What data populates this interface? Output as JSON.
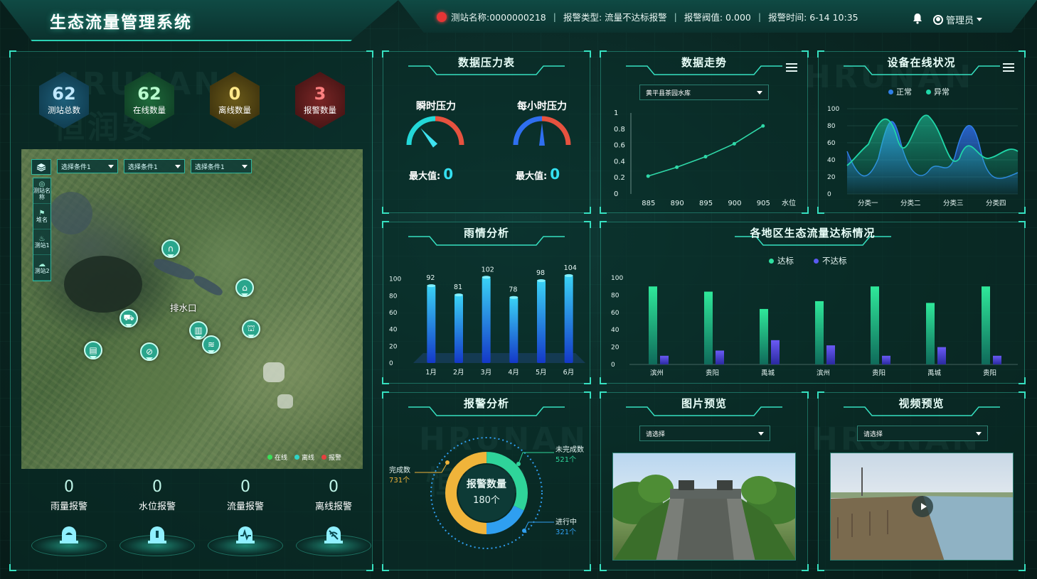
{
  "header": {
    "title": "生态流量管理系统",
    "alarm": {
      "station": "测站名称:0000000218",
      "type": "报警类型:  流量不达标报警",
      "threshold": "报警阀值:  0.000",
      "time": "报警时间:  6-14 10:35"
    },
    "user": "管理员"
  },
  "summary": [
    {
      "value": "62",
      "label": "测站总数",
      "color": "#4fb6e8"
    },
    {
      "value": "62",
      "label": "在线数量",
      "color": "#3de07a"
    },
    {
      "value": "0",
      "label": "离线数量",
      "color": "#e8c238"
    },
    {
      "value": "3",
      "label": "报警数量",
      "color": "#e84848"
    }
  ],
  "map": {
    "selects": [
      "选择条件1",
      "选择条件1",
      "选择条件1"
    ],
    "side_items": [
      "测站名称",
      "堆名",
      "测站1",
      "测站2"
    ],
    "label": "排水口",
    "legend": [
      "在线",
      "离线",
      "报警"
    ]
  },
  "alarms": [
    {
      "value": "0",
      "label": "雨量报警"
    },
    {
      "value": "0",
      "label": "水位报警"
    },
    {
      "value": "0",
      "label": "流量报警"
    },
    {
      "value": "0",
      "label": "离线报警"
    }
  ],
  "pressure": {
    "title": "数据压力表",
    "instant": {
      "label": "瞬时压力",
      "max_label": "最大值:",
      "max": "0"
    },
    "hourly": {
      "label": "每小时压力",
      "max_label": "最大值:",
      "max": "0"
    }
  },
  "trend": {
    "title": "数据走势",
    "select": "黄平县茶园水库",
    "chart_data": {
      "type": "line",
      "x": [
        885,
        890,
        895,
        900,
        905
      ],
      "y": [
        0.22,
        0.33,
        0.46,
        0.62,
        0.84
      ],
      "xlabel": "水位",
      "yticks": [
        "0",
        "0.2",
        "0.4",
        "0.6",
        "0.8",
        "1"
      ],
      "xticks": [
        "885",
        "890",
        "895",
        "900",
        "905"
      ]
    }
  },
  "online": {
    "title": "设备在线状况",
    "legend": [
      {
        "name": "正常",
        "color": "#2f7fe8"
      },
      {
        "name": "异常",
        "color": "#20d6a8"
      }
    ],
    "chart_data": {
      "type": "area",
      "categories": [
        "分类一",
        "分类二",
        "分类三",
        "分类四"
      ],
      "yticks": [
        "0",
        "20",
        "40",
        "60",
        "80",
        "100"
      ]
    }
  },
  "rain": {
    "title": "雨情分析",
    "chart_data": {
      "type": "bar",
      "categories": [
        "1月",
        "2月",
        "3月",
        "4月",
        "5月",
        "6月"
      ],
      "values": [
        92,
        81,
        102,
        78,
        98,
        104
      ],
      "yticks": [
        "0",
        "20",
        "40",
        "60",
        "80",
        "100"
      ]
    }
  },
  "region": {
    "title": "各地区生态流量达标情况",
    "chart_data": {
      "type": "bar",
      "categories": [
        "滨州",
        "贵阳",
        "禹城",
        "滨州",
        "贵阳",
        "禹城",
        "贵阳"
      ],
      "series": [
        {
          "name": "达标",
          "values": [
            90,
            84,
            64,
            73,
            90,
            71,
            90
          ],
          "color": "#2fe0a0"
        },
        {
          "name": "不达标",
          "values": [
            10,
            16,
            28,
            22,
            10,
            20,
            10
          ],
          "color": "#5a5af0"
        }
      ],
      "yticks": [
        "0",
        "20",
        "40",
        "60",
        "80",
        "100"
      ]
    }
  },
  "alarm_analysis": {
    "title": "报警分析",
    "center_label": "报警数量",
    "center_value": "180个",
    "items": [
      {
        "name": "完成数",
        "value": "731个",
        "color": "#f0b43a"
      },
      {
        "name": "未完成数",
        "value": "521个",
        "color": "#2fd49a"
      },
      {
        "name": "进行中",
        "value": "321个",
        "color": "#2f9ff0"
      }
    ]
  },
  "photo": {
    "title": "图片预览",
    "select": "请选择"
  },
  "video": {
    "title": "视频预览",
    "select": "请选择"
  },
  "watermark": {
    "en": "HRUNAN",
    "cn": "恒润安"
  }
}
